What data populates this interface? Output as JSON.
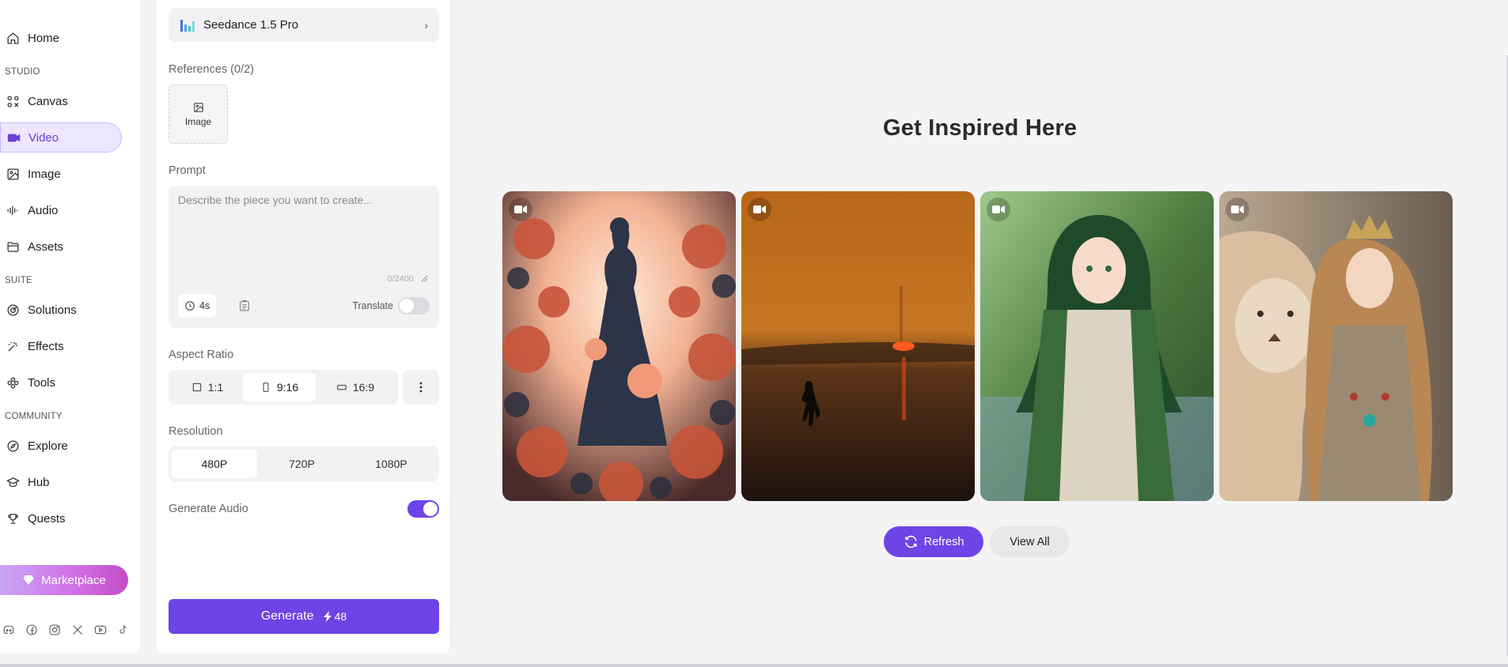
{
  "sidebar": {
    "items": [
      {
        "key": "home",
        "label": "Home",
        "icon": "home-icon"
      },
      {
        "key": "canvas",
        "label": "Canvas",
        "icon": "canvas-icon"
      },
      {
        "key": "video",
        "label": "Video",
        "icon": "video-icon",
        "active": true
      },
      {
        "key": "image",
        "label": "Image",
        "icon": "image-icon"
      },
      {
        "key": "audio",
        "label": "Audio",
        "icon": "audio-icon"
      },
      {
        "key": "assets",
        "label": "Assets",
        "icon": "assets-icon"
      },
      {
        "key": "solutions",
        "label": "Solutions",
        "icon": "solutions-icon"
      },
      {
        "key": "effects",
        "label": "Effects",
        "icon": "effects-icon"
      },
      {
        "key": "tools",
        "label": "Tools",
        "icon": "tools-icon"
      },
      {
        "key": "explore",
        "label": "Explore",
        "icon": "explore-icon"
      },
      {
        "key": "hub",
        "label": "Hub",
        "icon": "hub-icon"
      },
      {
        "key": "quests",
        "label": "Quests",
        "icon": "trophy-icon"
      }
    ],
    "sections": {
      "studio": "STUDIO",
      "suite": "SUITE",
      "community": "COMMUNITY"
    },
    "marketplace_label": "Marketplace",
    "socials": [
      "discord-icon",
      "facebook-icon",
      "instagram-icon",
      "x-icon",
      "youtube-icon",
      "tiktok-icon"
    ]
  },
  "panel": {
    "model_name": "Seedance 1.5 Pro",
    "references_label": "References (0/2)",
    "reference_slot_label": "Image",
    "prompt_label": "Prompt",
    "prompt_placeholder": "Describe the piece you want to create...",
    "prompt_value": "",
    "prompt_counter": "0/2400",
    "duration": "4s",
    "translate_label": "Translate",
    "translate_on": false,
    "aspect_ratio_label": "Aspect Ratio",
    "aspect_ratios": [
      {
        "label": "1:1",
        "icon": "square-icon",
        "selected": false
      },
      {
        "label": "9:16",
        "icon": "portrait-icon",
        "selected": true
      },
      {
        "label": "16:9",
        "icon": "landscape-icon",
        "selected": false
      }
    ],
    "resolution_label": "Resolution",
    "resolutions": [
      {
        "label": "480P",
        "selected": true
      },
      {
        "label": "720P",
        "selected": false
      },
      {
        "label": "1080P",
        "selected": false
      }
    ],
    "generate_audio_label": "Generate Audio",
    "generate_audio_on": true,
    "generate_label": "Generate",
    "generate_cost": "48"
  },
  "main": {
    "title": "Get Inspired Here",
    "cards": [
      {
        "icon": "video-badge-icon",
        "scene": "floral paper-cut woman"
      },
      {
        "icon": "video-badge-icon",
        "scene": "sunset beach walker"
      },
      {
        "icon": "video-badge-icon",
        "scene": "green-haired anime girl"
      },
      {
        "icon": "video-badge-icon",
        "scene": "queen with lion"
      }
    ],
    "refresh_label": "Refresh",
    "view_all_label": "View All"
  },
  "colors": {
    "accent": "#6e44e6",
    "active_bg": "#ece6ff",
    "panel_bg": "#f2f2f4"
  }
}
